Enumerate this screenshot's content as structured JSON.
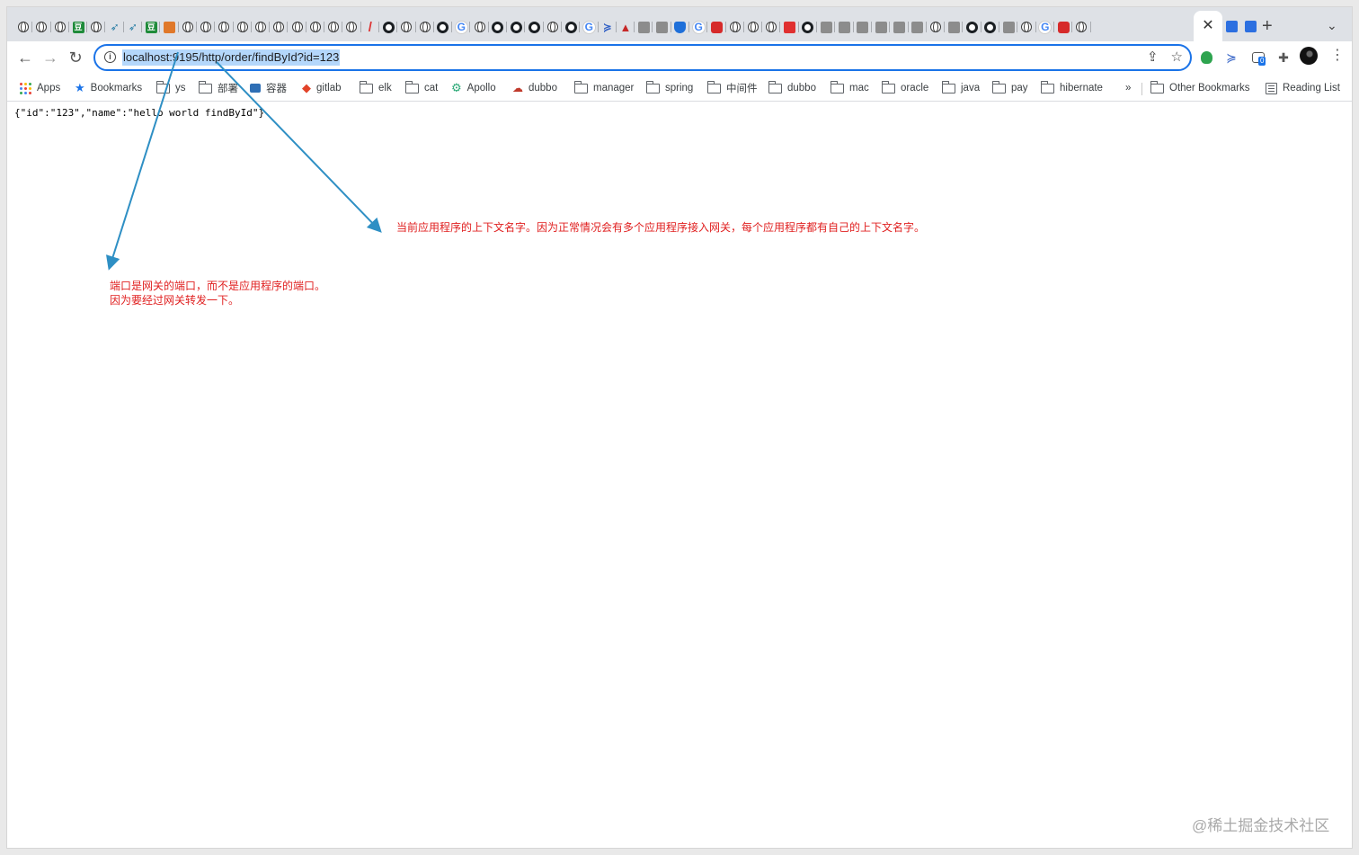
{
  "tabs": {
    "favicons": [
      "globe",
      "globe",
      "globe",
      "green",
      "globe",
      "bird",
      "bird",
      "green",
      "orange",
      "globe",
      "globe",
      "globe",
      "globe",
      "globe",
      "globe",
      "globe",
      "globe",
      "globe",
      "globe",
      "slash",
      "gh",
      "globe",
      "globe",
      "gh",
      "g",
      "globe",
      "gh",
      "gh",
      "gh",
      "globe",
      "gh",
      "g",
      "chev",
      "tri",
      "robot",
      "robot",
      "shield",
      "g",
      "red",
      "globe",
      "globe",
      "globe",
      "redsq",
      "gh",
      "robot",
      "robot",
      "robot",
      "robot",
      "robot",
      "robot",
      "globe",
      "robot",
      "gh",
      "gh",
      "robot",
      "globe",
      "g",
      "red",
      "globe"
    ],
    "active_close_icon": "✕",
    "new_tab_icon": "+",
    "menu_icon": "⌄"
  },
  "toolbar": {
    "back_icon": "←",
    "forward_icon": "→",
    "reload_icon": "↻",
    "url": "localhost:9195/http/order/findById?id=123",
    "share_icon": "⇪",
    "bookmark_icon": "☆",
    "extension_badge": "0",
    "menu_icon": "⋮"
  },
  "bookmarks": {
    "items": [
      {
        "label": "Apps",
        "icon": "apps-grid"
      },
      {
        "label": "Bookmarks",
        "icon": "star"
      },
      {
        "label": "ys",
        "icon": "folder"
      },
      {
        "label": "部署",
        "icon": "folder"
      },
      {
        "label": "容器",
        "icon": "deploy"
      },
      {
        "label": "gitlab",
        "icon": "gitlab"
      },
      {
        "label": "elk",
        "icon": "folder"
      },
      {
        "label": "cat",
        "icon": "folder"
      },
      {
        "label": "Apollo",
        "icon": "apollo"
      },
      {
        "label": "dubbo",
        "icon": "dubbo"
      },
      {
        "label": "manager",
        "icon": "folder"
      },
      {
        "label": "spring",
        "icon": "folder"
      },
      {
        "label": "中间件",
        "icon": "folder"
      },
      {
        "label": "dubbo",
        "icon": "folder"
      },
      {
        "label": "mac",
        "icon": "folder"
      },
      {
        "label": "oracle",
        "icon": "folder"
      },
      {
        "label": "java",
        "icon": "folder"
      },
      {
        "label": "pay",
        "icon": "folder"
      },
      {
        "label": "hibernate",
        "icon": "folder"
      }
    ],
    "overflow_label": "»",
    "other_bookmarks": "Other Bookmarks",
    "reading_list": "Reading List"
  },
  "page": {
    "json_response": "{\"id\":\"123\",\"name\":\"hello world findById\"}",
    "annotation_context": "当前应用程序的上下文名字。因为正常情况会有多个应用程序接入网关，每个应用程序都有自己的上下文名字。",
    "annotation_port_line1": "端口是网关的端口，而不是应用程序的端口。",
    "annotation_port_line2": "因为要经过网关转发一下。",
    "watermark": "@稀土掘金技术社区"
  },
  "colors": {
    "annotation": "#e02020",
    "arrow": "#2e8fc4",
    "url_highlight": "#b4d7fb",
    "focus_ring": "#1a73e8"
  }
}
